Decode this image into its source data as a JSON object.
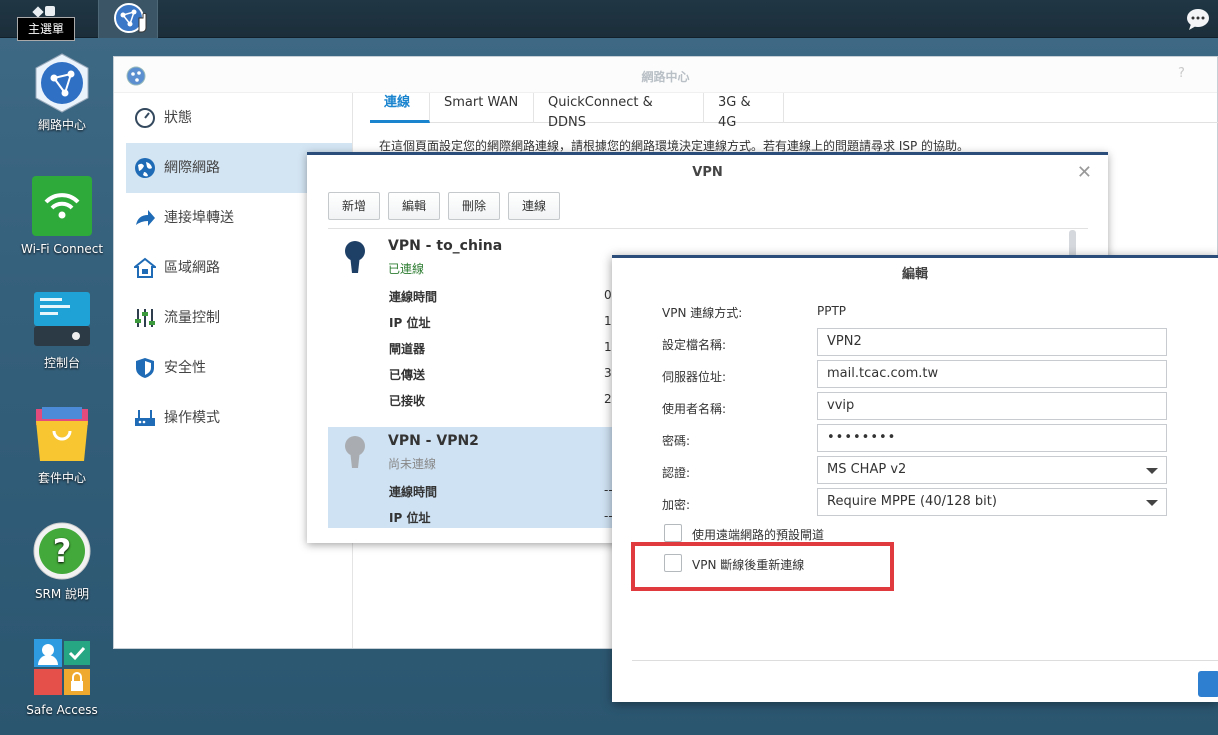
{
  "taskbar": {
    "home_tooltip": "主選單",
    "app_name": "網路中心"
  },
  "desktop": [
    {
      "label": "網路中心"
    },
    {
      "label": "Wi-Fi Connect"
    },
    {
      "label": "控制台"
    },
    {
      "label": "套件中心"
    },
    {
      "label": "SRM 說明"
    },
    {
      "label": "Safe Access"
    }
  ],
  "main": {
    "title": "網路中心",
    "help": "?",
    "sidebar": [
      {
        "label": "狀態"
      },
      {
        "label": "網際網路"
      },
      {
        "label": "連接埠轉送"
      },
      {
        "label": "區域網路"
      },
      {
        "label": "流量控制"
      },
      {
        "label": "安全性"
      },
      {
        "label": "操作模式"
      }
    ],
    "tabs": [
      {
        "label": "連線"
      },
      {
        "label": "Smart WAN"
      },
      {
        "label": "QuickConnect & DDNS"
      },
      {
        "label": "3G & 4G"
      }
    ],
    "description": "在這個頁面設定您的網際網路連線，請根據您的網路環境決定連線方式。若有連線上的問題請尋求 ISP 的協助。"
  },
  "vpn": {
    "title": "VPN",
    "close": "✕",
    "buttons": {
      "add": "新增",
      "edit": "編輯",
      "delete": "刪除",
      "connect": "連線"
    },
    "connections": [
      {
        "name": "VPN - to_china",
        "status": "已連線",
        "fields": [
          {
            "label": "連線時間",
            "value": "0"
          },
          {
            "label": "IP 位址",
            "value": "1"
          },
          {
            "label": "閘道器",
            "value": "1"
          },
          {
            "label": "已傳送",
            "value": "3"
          },
          {
            "label": "已接收",
            "value": "2"
          }
        ]
      },
      {
        "name": "VPN - VPN2",
        "status": "尚未連線",
        "fields": [
          {
            "label": "連線時間",
            "value": "--"
          },
          {
            "label": "IP 位址",
            "value": "--"
          }
        ]
      }
    ]
  },
  "edit": {
    "title": "編輯",
    "method_label": "VPN 連線方式:",
    "method_value": "PPTP",
    "profile_label": "設定檔名稱:",
    "profile_value": "VPN2",
    "server_label": "伺服器位址:",
    "server_value": "mail.tcac.com.tw",
    "user_label": "使用者名稱:",
    "user_value": "vvip",
    "password_label": "密碼:",
    "password_value": "••••••••",
    "auth_label": "認證:",
    "auth_value": "MS CHAP v2",
    "enc_label": "加密:",
    "enc_value": "Require MPPE (40/128 bit)",
    "gateway_checkbox": "使用遠端網路的預設閘道",
    "reconnect_checkbox": "VPN 斷線後重新連線"
  },
  "colors": {
    "accent": "#1a84cf",
    "highlight": "#e0393e",
    "dialog_border": "#2a4d7a"
  }
}
